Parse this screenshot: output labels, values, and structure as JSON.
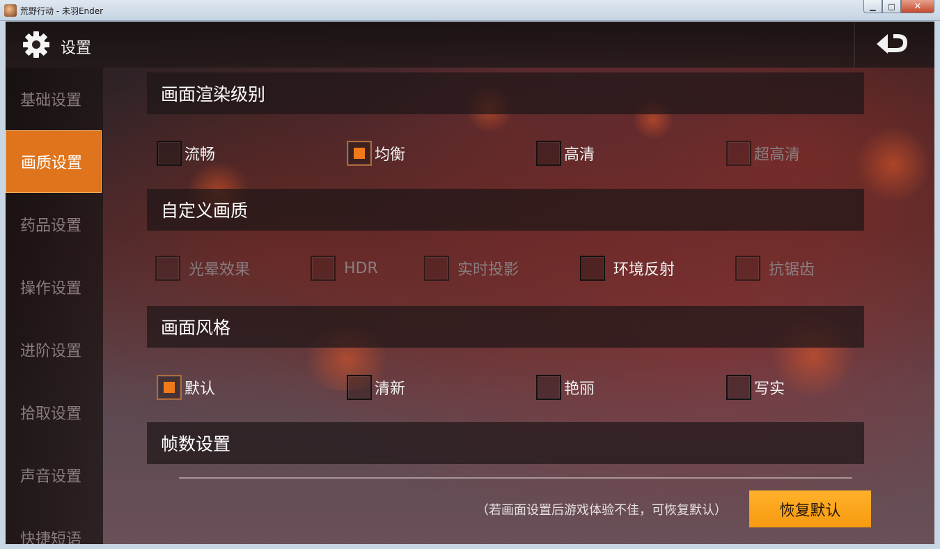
{
  "window": {
    "title": "荒野行动 - 未羽Ender",
    "min_glyph": "▁",
    "max_glyph": "□",
    "close_glyph": "✕"
  },
  "header": {
    "title": "设置",
    "icon": "gear-icon",
    "back_icon": "back-arrow-icon"
  },
  "sidebar": {
    "items": [
      {
        "label": "基础设置",
        "active": false
      },
      {
        "label": "画质设置",
        "active": true
      },
      {
        "label": "药品设置",
        "active": false
      },
      {
        "label": "操作设置",
        "active": false
      },
      {
        "label": "进阶设置",
        "active": false
      },
      {
        "label": "拾取设置",
        "active": false
      },
      {
        "label": "声音设置",
        "active": false
      },
      {
        "label": "快捷短语",
        "active": false
      }
    ]
  },
  "sections": {
    "render_level": {
      "title": "画面渲染级别",
      "options": [
        {
          "label": "流畅",
          "checked": false,
          "enabled": true
        },
        {
          "label": "均衡",
          "checked": true,
          "enabled": true
        },
        {
          "label": "高清",
          "checked": false,
          "enabled": true
        },
        {
          "label": "超高清",
          "checked": false,
          "enabled": false
        }
      ]
    },
    "custom_quality": {
      "title": "自定义画质",
      "options": [
        {
          "label": "光晕效果",
          "checked": false,
          "enabled": false
        },
        {
          "label": "HDR",
          "checked": false,
          "enabled": false
        },
        {
          "label": "实时投影",
          "checked": false,
          "enabled": false
        },
        {
          "label": "环境反射",
          "checked": false,
          "enabled": true
        },
        {
          "label": "抗锯齿",
          "checked": false,
          "enabled": false
        }
      ]
    },
    "style": {
      "title": "画面风格",
      "options": [
        {
          "label": "默认",
          "checked": true,
          "enabled": true
        },
        {
          "label": "清新",
          "checked": false,
          "enabled": true
        },
        {
          "label": "艳丽",
          "checked": false,
          "enabled": true
        },
        {
          "label": "写实",
          "checked": false,
          "enabled": true
        }
      ]
    },
    "framerate": {
      "title": "帧数设置"
    }
  },
  "footer": {
    "hint": "（若画面设置后游戏体验不佳，可恢复默认）",
    "restore_label": "恢复默认"
  },
  "colors": {
    "accent": "#e0741c",
    "button": "#f79a10",
    "check_mark": "#f07a1a"
  }
}
